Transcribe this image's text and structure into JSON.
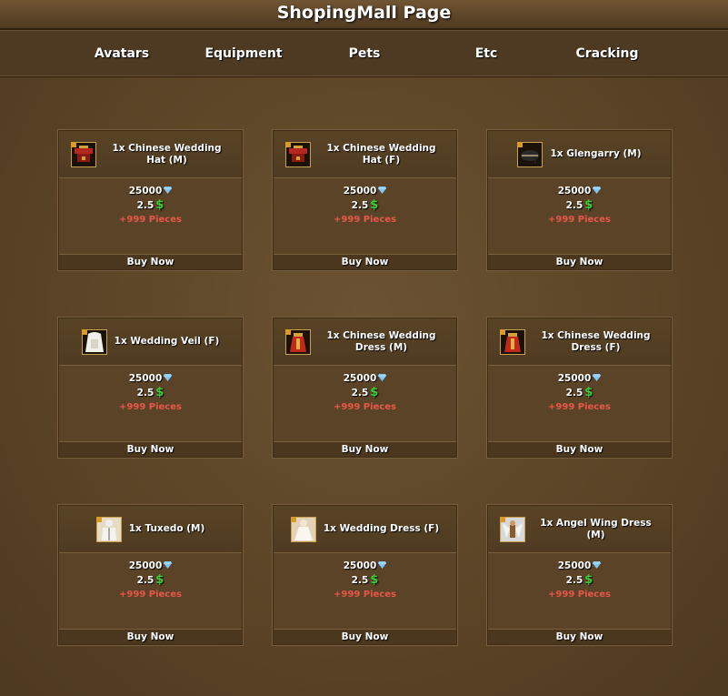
{
  "page": {
    "title": "ShopingMall Page"
  },
  "nav": [
    {
      "label": "Avatars"
    },
    {
      "label": "Equipment"
    },
    {
      "label": "Pets"
    },
    {
      "label": "Etc"
    },
    {
      "label": "Cracking"
    }
  ],
  "items": [
    {
      "name": "1x Chinese Wedding Hat (M)",
      "diamonds": "25000",
      "cash": "2.5",
      "stock": "+999 Pieces",
      "buy": "Buy Now",
      "icon": "chinese-wedding-hat-icon"
    },
    {
      "name": "1x Chinese Wedding Hat (F)",
      "diamonds": "25000",
      "cash": "2.5",
      "stock": "+999 Pieces",
      "buy": "Buy Now",
      "icon": "chinese-wedding-hat-icon"
    },
    {
      "name": "1x Glengarry (M)",
      "diamonds": "25000",
      "cash": "2.5",
      "stock": "+999 Pieces",
      "buy": "Buy Now",
      "icon": "glengarry-icon"
    },
    {
      "name": "1x Wedding Veil (F)",
      "diamonds": "25000",
      "cash": "2.5",
      "stock": "+999 Pieces",
      "buy": "Buy Now",
      "icon": "wedding-veil-icon"
    },
    {
      "name": "1x Chinese Wedding Dress (M)",
      "diamonds": "25000",
      "cash": "2.5",
      "stock": "+999 Pieces",
      "buy": "Buy Now",
      "icon": "chinese-wedding-dress-icon"
    },
    {
      "name": "1x Chinese Wedding Dress (F)",
      "diamonds": "25000",
      "cash": "2.5",
      "stock": "+999 Pieces",
      "buy": "Buy Now",
      "icon": "chinese-wedding-dress-icon"
    },
    {
      "name": "1x Tuxedo (M)",
      "diamonds": "25000",
      "cash": "2.5",
      "stock": "+999 Pieces",
      "buy": "Buy Now",
      "icon": "tuxedo-icon"
    },
    {
      "name": "1x Wedding Dress (F)",
      "diamonds": "25000",
      "cash": "2.5",
      "stock": "+999 Pieces",
      "buy": "Buy Now",
      "icon": "wedding-dress-icon"
    },
    {
      "name": "1x Angel Wing Dress (M)",
      "diamonds": "25000",
      "cash": "2.5",
      "stock": "+999 Pieces",
      "buy": "Buy Now",
      "icon": "angel-wing-dress-icon"
    }
  ],
  "currency_icons": {
    "diamond": "diamond-icon",
    "cash": "dollar-icon"
  },
  "colors": {
    "stock_text": "#e8574a",
    "cash_symbol": "#3fcf3a",
    "diamond": "#7fc8ff"
  }
}
